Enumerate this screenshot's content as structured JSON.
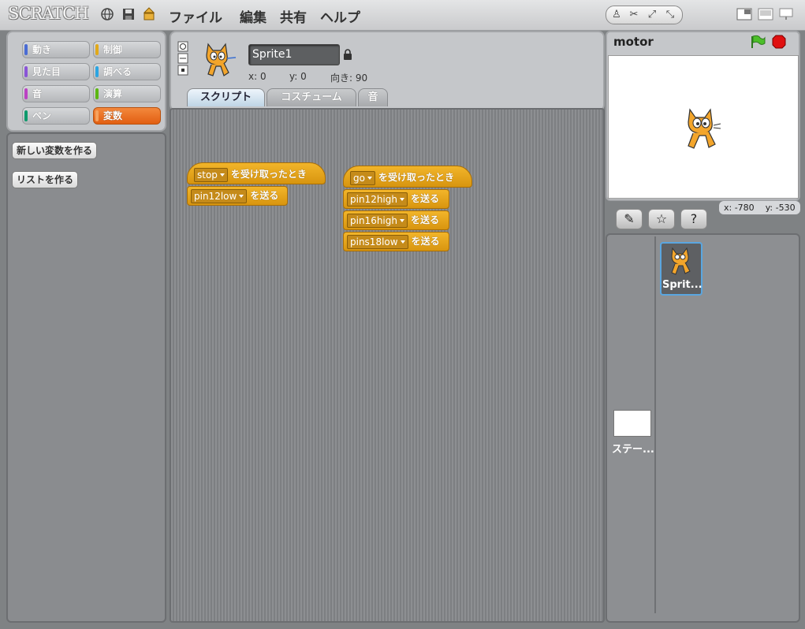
{
  "app": {
    "logo": "SCRATCH"
  },
  "menu": {
    "file": "ファイル",
    "edit": "編集",
    "share": "共有",
    "help": "ヘルプ"
  },
  "categories": [
    {
      "label": "動き",
      "color": "#4a6cd4"
    },
    {
      "label": "制御",
      "color": "#e1a91a"
    },
    {
      "label": "見た目",
      "color": "#8a55d7"
    },
    {
      "label": "調べる",
      "color": "#2ca5e2"
    },
    {
      "label": "音",
      "color": "#bb42c3"
    },
    {
      "label": "演算",
      "color": "#5cb712"
    },
    {
      "label": "ペン",
      "color": "#0e9a6c"
    },
    {
      "label": "変数",
      "color": "#ee7d16"
    }
  ],
  "palette": {
    "new_variable": "新しい変数を作る",
    "new_list": "リストを作る"
  },
  "sprite": {
    "name": "Sprite1",
    "x_label": "x: 0",
    "y_label": "y: 0",
    "direction_label": "向き: 90"
  },
  "tabs": {
    "scripts": "スクリプト",
    "costumes": "コスチューム",
    "sounds": "音"
  },
  "scripts": [
    {
      "hat": {
        "dropdown": "stop",
        "text": "を受け取ったとき"
      },
      "blocks": [
        {
          "dropdown": "pin12low",
          "text": "を送る"
        }
      ]
    },
    {
      "hat": {
        "dropdown": "go",
        "text": "を受け取ったとき"
      },
      "blocks": [
        {
          "dropdown": "pin12high",
          "text": "を送る"
        },
        {
          "dropdown": "pin16high",
          "text": "を送る"
        },
        {
          "dropdown": "pins18low",
          "text": "を送る"
        }
      ]
    }
  ],
  "stage": {
    "project_name": "motor",
    "mouse_x": "x: -780",
    "mouse_y": "y: -530"
  },
  "sprites_list": {
    "sprite_label": "Sprit...",
    "stage_label": "ステー..."
  },
  "colors": {
    "control": "#e1a91a",
    "variables_active": "#ee7d16",
    "selection": "#5aa6e0"
  }
}
